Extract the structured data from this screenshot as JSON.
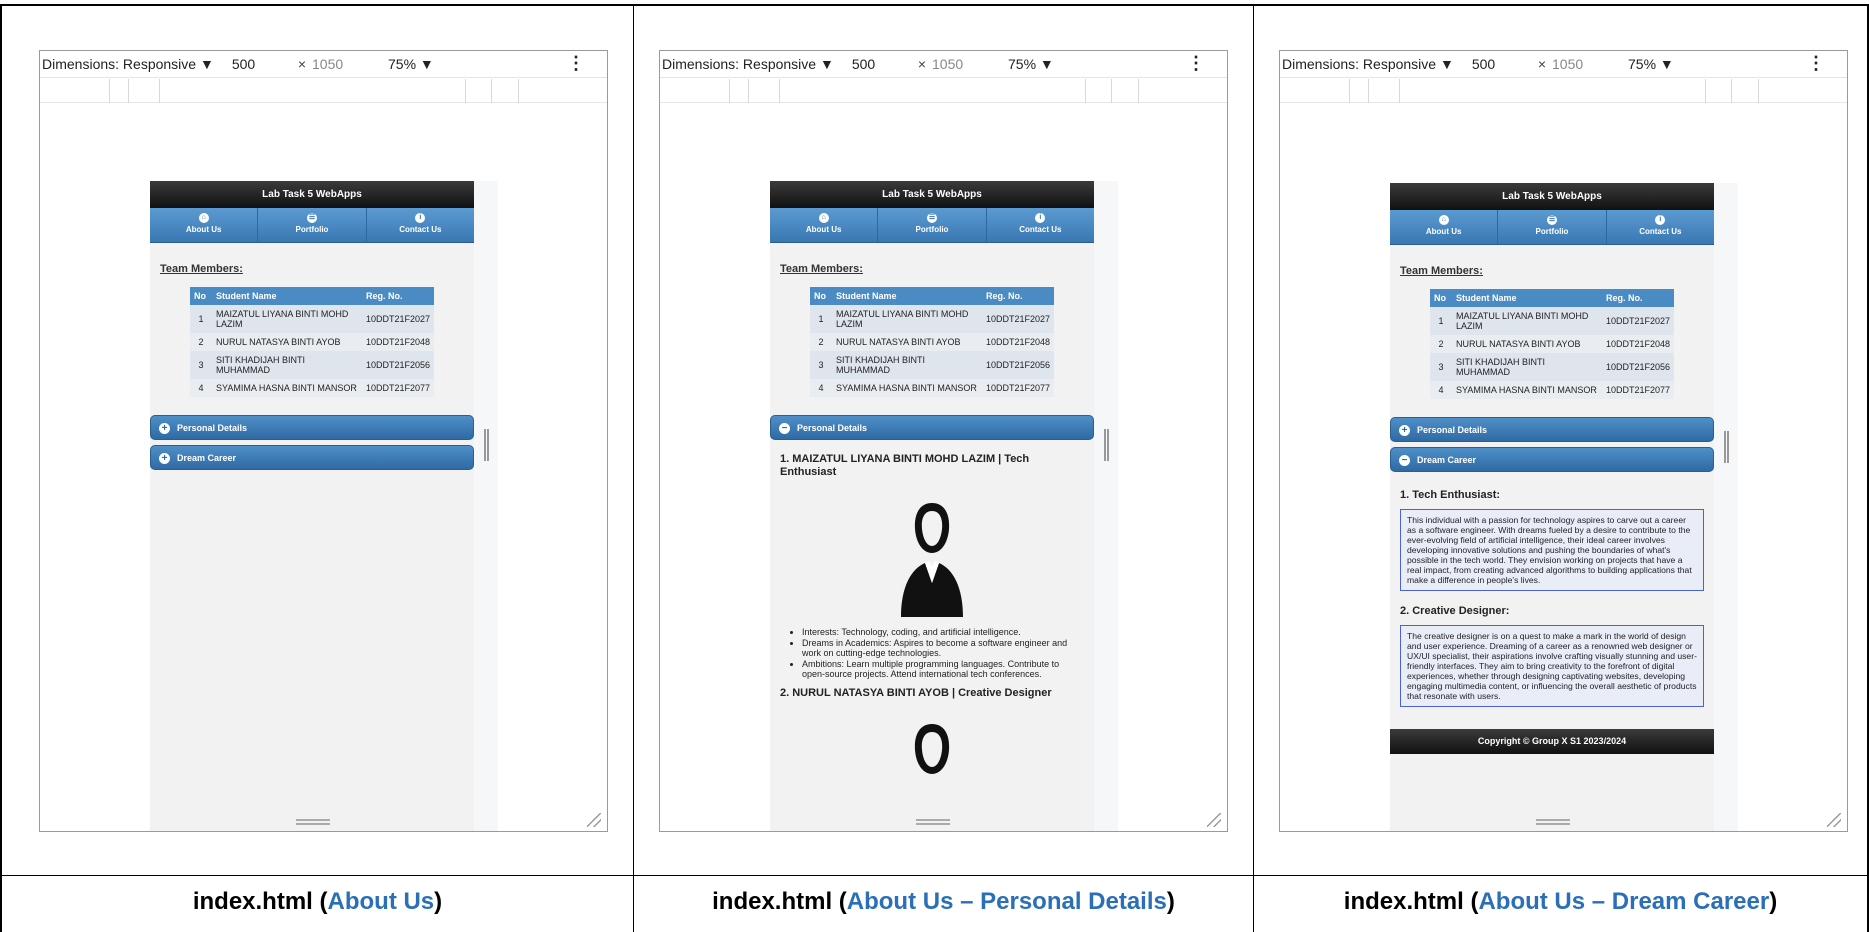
{
  "toolbar": {
    "dimensions_label": "Dimensions: Responsive ▼",
    "width": "500",
    "times": "×",
    "height": "1050",
    "zoom": "75% ▼",
    "more": "⋮"
  },
  "app": {
    "title": "Lab Task 5 WebApps",
    "nav": [
      {
        "label": "About Us",
        "icon": "home-icon"
      },
      {
        "label": "Portfolio",
        "icon": "grid-icon"
      },
      {
        "label": "Contact Us",
        "icon": "info-icon"
      }
    ]
  },
  "team": {
    "heading": "Team Members:",
    "columns": [
      "No",
      "Student Name",
      "Reg. No."
    ],
    "rows": [
      {
        "no": "1",
        "name": "MAIZATUL LIYANA BINTI MOHD LAZIM",
        "reg": "10DDT21F2027"
      },
      {
        "no": "2",
        "name": "NURUL NATASYA BINTI AYOB",
        "reg": "10DDT21F2048"
      },
      {
        "no": "3",
        "name": "SITI KHADIJAH BINTI MUHAMMAD",
        "reg": "10DDT21F2056"
      },
      {
        "no": "4",
        "name": "SYAMIMA HASNA BINTI MANSOR",
        "reg": "10DDT21F2077"
      }
    ]
  },
  "sections": {
    "personal": "Personal Details",
    "dream": "Dream Career"
  },
  "personal": {
    "p1_title": "1. MAIZATUL LIYANA BINTI MOHD LAZIM | Tech Enthusiast",
    "p1_bullets": [
      "Interests: Technology, coding, and artificial intelligence.",
      "Dreams in Academics: Aspires to become a software engineer and work on cutting-edge technologies.",
      "Ambitions: Learn multiple programming languages. Contribute to open-source projects. Attend international tech conferences."
    ],
    "p2_title": "2. NURUL NATASYA BINTI AYOB | Creative Designer"
  },
  "dream": {
    "d1_title": "1. Tech Enthusiast:",
    "d1_text": "This individual with a passion for technology aspires to carve out a career as a software engineer. With dreams fueled by a desire to contribute to the ever-evolving field of artificial intelligence, their ideal career involves developing innovative solutions and pushing the boundaries of what's possible in the tech world. They envision working on projects that have a real impact, from creating advanced algorithms to building applications that make a difference in people's lives.",
    "d2_title": "2. Creative Designer:",
    "d2_text": "The creative designer is on a quest to make a mark in the world of design and user experience. Dreaming of a career as a renowned web designer or UX/UI specialist, their aspirations involve crafting visually stunning and user-friendly interfaces. They aim to bring creativity to the forefront of digital experiences, whether through designing captivating websites, developing engaging multimedia content, or influencing the overall aesthetic of products that resonate with users."
  },
  "footer": "Copyright © Group X S1 2023/2024",
  "captions": [
    {
      "prefix": "index.html (",
      "highlight": "About Us",
      "suffix": ")"
    },
    {
      "prefix": "index.html (",
      "highlight": "About Us – Personal Details",
      "suffix": ")"
    },
    {
      "prefix": "index.html (",
      "highlight": "About Us – Dream Career",
      "suffix": ")"
    }
  ],
  "colors": {
    "accent": "#2a6fb7",
    "header": "#1a1a1a",
    "nav": "#4a8bc4"
  }
}
